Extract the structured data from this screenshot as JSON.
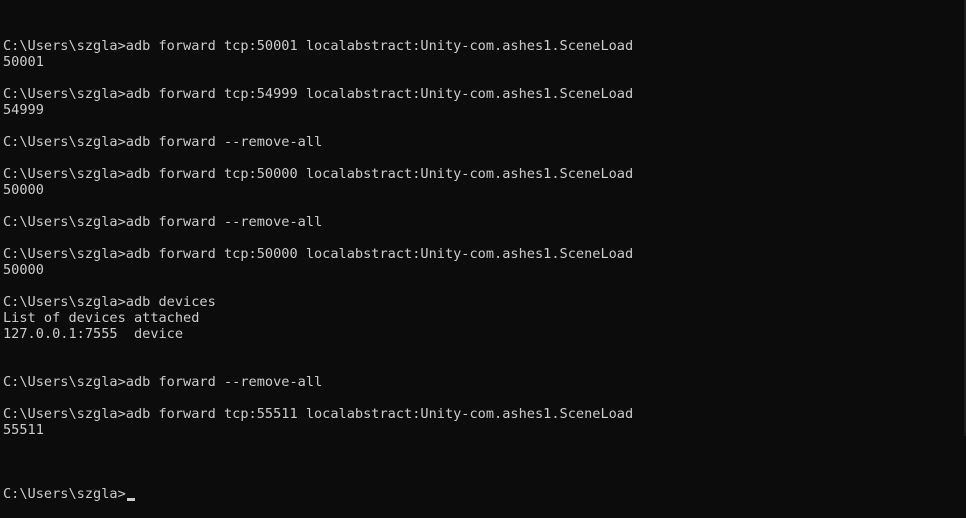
{
  "terminal": {
    "lines": [
      "C:\\Users\\szgla>adb forward tcp:50001 localabstract:Unity-com.ashes1.SceneLoad",
      "50001",
      "",
      "C:\\Users\\szgla>adb forward tcp:54999 localabstract:Unity-com.ashes1.SceneLoad",
      "54999",
      "",
      "C:\\Users\\szgla>adb forward --remove-all",
      "",
      "C:\\Users\\szgla>adb forward tcp:50000 localabstract:Unity-com.ashes1.SceneLoad",
      "50000",
      "",
      "C:\\Users\\szgla>adb forward --remove-all",
      "",
      "C:\\Users\\szgla>adb forward tcp:50000 localabstract:Unity-com.ashes1.SceneLoad",
      "50000",
      "",
      "C:\\Users\\szgla>adb devices",
      "List of devices attached",
      "127.0.0.1:7555  device",
      "",
      "",
      "C:\\Users\\szgla>adb forward --remove-all",
      "",
      "C:\\Users\\szgla>adb forward tcp:55511 localabstract:Unity-com.ashes1.SceneLoad",
      "55511",
      ""
    ],
    "prompt": "C:\\Users\\szgla>",
    "colors": {
      "background": "#0c0c0c",
      "foreground": "#cccccc"
    }
  }
}
